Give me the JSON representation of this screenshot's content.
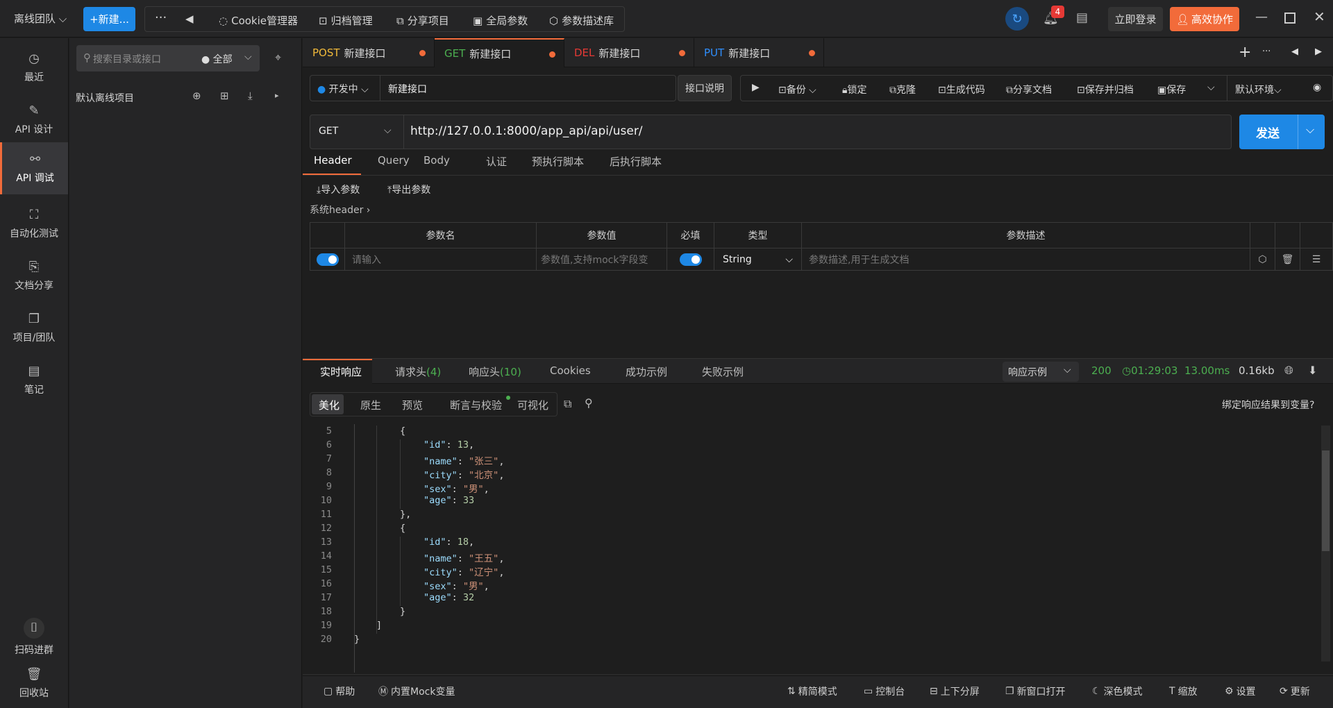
{
  "topbar": {
    "team": "离线团队",
    "new_button": "+新建...",
    "more": "···",
    "back": "◀",
    "tools": [
      {
        "icon": "cookie-icon",
        "label": "Cookie管理器"
      },
      {
        "icon": "archive-icon",
        "label": "归档管理"
      },
      {
        "icon": "share-icon",
        "label": "分享项目"
      },
      {
        "icon": "global-params-icon",
        "label": "全局参数"
      },
      {
        "icon": "cube-icon",
        "label": "参数描述库"
      }
    ],
    "notification_count": "4",
    "login": "立即登录",
    "collab": "高效协作"
  },
  "nav": {
    "items": [
      {
        "icon": "clock-icon",
        "label": "最近"
      },
      {
        "icon": "edit-icon",
        "label": "API 设计"
      },
      {
        "icon": "link-icon",
        "label": "API 调试"
      },
      {
        "icon": "flow-icon",
        "label": "自动化测试"
      },
      {
        "icon": "doc-share-icon",
        "label": "文档分享"
      },
      {
        "icon": "project-icon",
        "label": "项目/团队"
      },
      {
        "icon": "note-icon",
        "label": "笔记"
      }
    ],
    "bottom": [
      {
        "icon": "scan-icon",
        "label": "扫码进群"
      },
      {
        "icon": "trash-icon",
        "label": "回收站"
      }
    ]
  },
  "tree": {
    "search_placeholder": "搜索目录或接口",
    "filter": "全部",
    "project": "默认离线项目"
  },
  "tabs": [
    {
      "method": "POST",
      "name": "新建接口",
      "color": "#f0b93a"
    },
    {
      "method": "GET",
      "name": "新建接口",
      "color": "#4caf50"
    },
    {
      "method": "DEL",
      "name": "新建接口",
      "color": "#e53935"
    },
    {
      "method": "PUT",
      "name": "新建接口",
      "color": "#2f8fff"
    }
  ],
  "request": {
    "status": "开发中",
    "name": "新建接口",
    "doc_button": "接口说明",
    "actions": [
      "备份",
      "锁定",
      "克隆",
      "生成代码",
      "分享文档",
      "保存并归档",
      "保存"
    ],
    "env": "默认环境",
    "method": "GET",
    "url": "http://127.0.0.1:8000/app_api/api/user/",
    "send": "发送"
  },
  "req_tabs": [
    "Header",
    "Query",
    "Body",
    "认证",
    "预执行脚本",
    "后执行脚本"
  ],
  "header_panel": {
    "import": "导入参数",
    "export": "导出参数",
    "system_header": "系统header",
    "columns": [
      "参数名",
      "参数值",
      "必填",
      "类型",
      "参数描述"
    ],
    "row": {
      "name_placeholder": "请输入",
      "value_placeholder": "参数值,支持mock字段变",
      "type": "String",
      "desc_placeholder": "参数描述,用于生成文档"
    }
  },
  "response": {
    "tabs": [
      "实时响应",
      "请求头",
      "(4)",
      "响应头",
      "(10)",
      "Cookies",
      "成功示例",
      "失败示例"
    ],
    "example_select": "响应示例",
    "status_code": "200",
    "time": "01:29:03",
    "duration": "13.00ms",
    "size": "0.16kb",
    "view_tabs": [
      "美化",
      "原生",
      "预览",
      "断言与校验",
      "可视化"
    ],
    "bind": "绑定响应结果到变量?"
  },
  "code": [
    {
      "no": "5",
      "text": "{"
    },
    {
      "no": "6",
      "key": "\"id\"",
      "val": "13",
      "type": "n"
    },
    {
      "no": "7",
      "key": "\"name\"",
      "val": "\"张三\"",
      "type": "s"
    },
    {
      "no": "8",
      "key": "\"city\"",
      "val": "\"北京\"",
      "type": "s"
    },
    {
      "no": "9",
      "key": "\"sex\"",
      "val": "\"男\"",
      "type": "s"
    },
    {
      "no": "10",
      "key": "\"age\"",
      "val": "33",
      "type": "n",
      "last": true
    },
    {
      "no": "11",
      "text": "},"
    },
    {
      "no": "12",
      "text": "{"
    },
    {
      "no": "13",
      "key": "\"id\"",
      "val": "18",
      "type": "n"
    },
    {
      "no": "14",
      "key": "\"name\"",
      "val": "\"王五\"",
      "type": "s"
    },
    {
      "no": "15",
      "key": "\"city\"",
      "val": "\"辽宁\"",
      "type": "s"
    },
    {
      "no": "16",
      "key": "\"sex\"",
      "val": "\"男\"",
      "type": "s"
    },
    {
      "no": "17",
      "key": "\"age\"",
      "val": "32",
      "type": "n",
      "last": true
    },
    {
      "no": "18",
      "text": "}"
    },
    {
      "no": "19",
      "text": "]"
    },
    {
      "no": "20",
      "text": "}"
    }
  ],
  "footer": {
    "left": [
      "帮助",
      "内置Mock变量"
    ],
    "right": [
      "精简模式",
      "控制台",
      "上下分屏",
      "新窗口打开",
      "深色模式",
      "缩放",
      "设置",
      "更新"
    ]
  }
}
